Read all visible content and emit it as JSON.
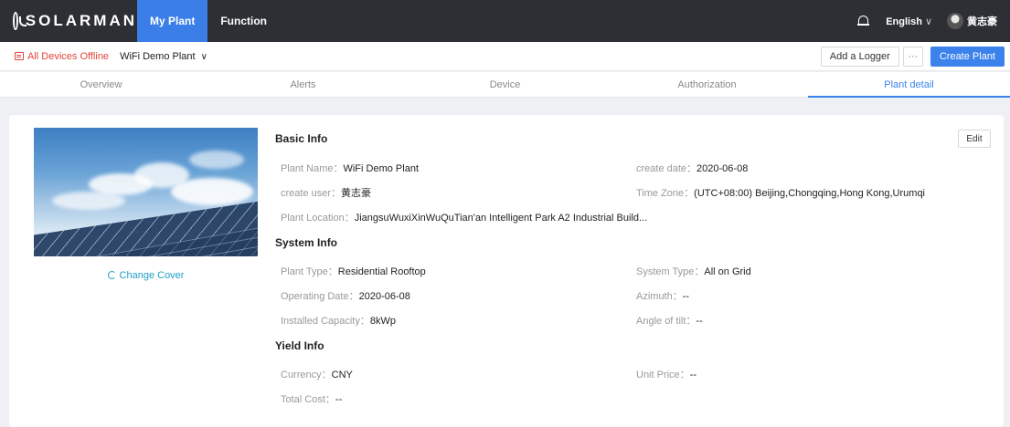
{
  "brand": {
    "name": "SOLARMAN"
  },
  "nav": {
    "items": [
      {
        "label": "My Plant"
      },
      {
        "label": "Function"
      }
    ]
  },
  "topbar": {
    "language": "English",
    "language_chevron": "∨",
    "username": "黄志豪"
  },
  "subbar": {
    "status": "All Devices Offline",
    "plant_name": "WiFi Demo Plant",
    "plant_chevron": "∨",
    "add_logger": "Add a Logger",
    "more": "···",
    "create_plant": "Create Plant"
  },
  "tabs": [
    {
      "label": "Overview"
    },
    {
      "label": "Alerts"
    },
    {
      "label": "Device"
    },
    {
      "label": "Authorization"
    },
    {
      "label": "Plant detail",
      "active": true
    }
  ],
  "cover": {
    "change_label": "Change Cover"
  },
  "edit_label": "Edit",
  "basic_info": {
    "title": "Basic Info",
    "plant_name_label": "Plant Name：",
    "plant_name": "WiFi Demo Plant",
    "create_date_label": "create date：",
    "create_date": "2020-06-08",
    "create_user_label": "create user：",
    "create_user": "黄志豪",
    "time_zone_label": "Time Zone：",
    "time_zone": "(UTC+08:00) Beijing,Chongqing,Hong Kong,Urumqi",
    "location_label": "Plant Location：",
    "location": "JiangsuWuxiXinWuQuTian'an Intelligent Park A2 Industrial Build..."
  },
  "system_info": {
    "title": "System Info",
    "plant_type_label": "Plant Type：",
    "plant_type": "Residential Rooftop",
    "system_type_label": "System Type：",
    "system_type": "All on Grid",
    "operating_date_label": "Operating Date：",
    "operating_date": "2020-06-08",
    "azimuth_label": "Azimuth：",
    "azimuth": "--",
    "capacity_label": "Installed Capacity：",
    "capacity": "8kWp",
    "tilt_label": "Angle of tilt：",
    "tilt": "--"
  },
  "yield_info": {
    "title": "Yield Info",
    "currency_label": "Currency：",
    "currency": "CNY",
    "unit_price_label": "Unit Price：",
    "unit_price": "--",
    "total_cost_label": "Total Cost：",
    "total_cost": "--"
  }
}
